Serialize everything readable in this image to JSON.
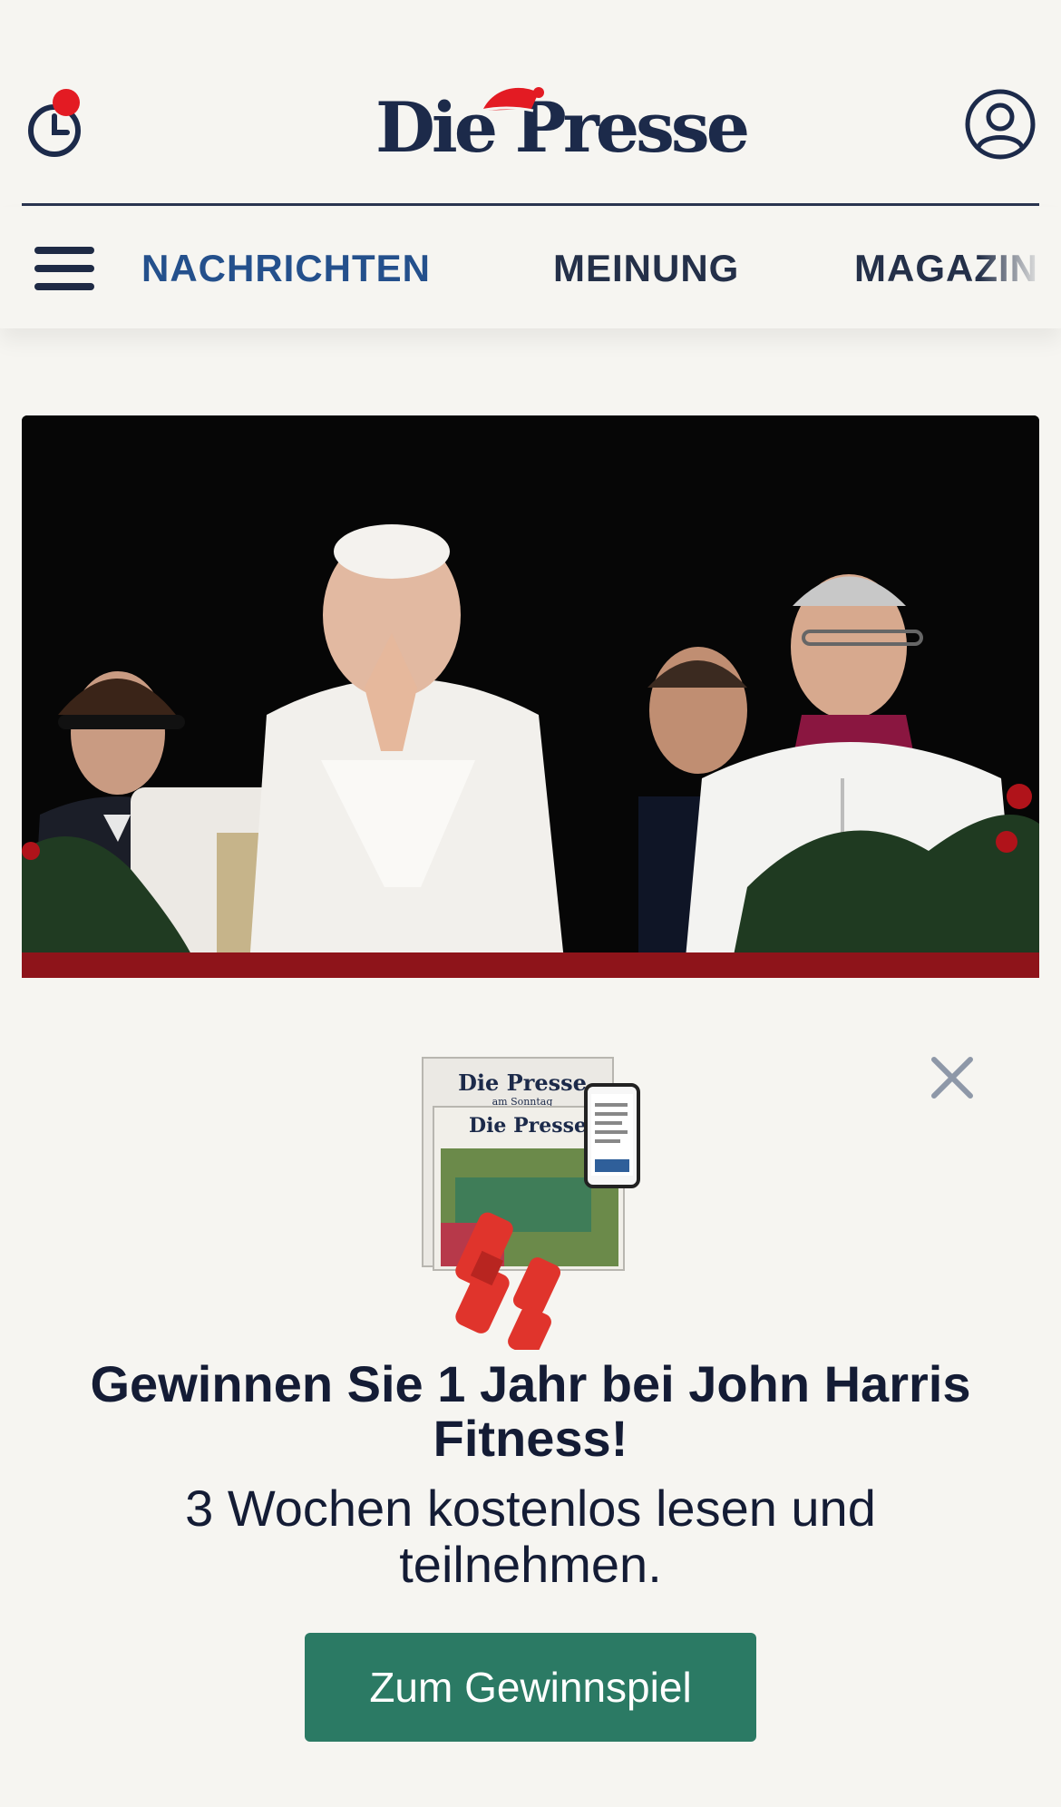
{
  "header": {
    "brand": "Die Presse",
    "history_icon": "clock-icon",
    "account_icon": "user-icon",
    "notification_dot_color": "#e31b23"
  },
  "nav": {
    "menu_icon": "hamburger-icon",
    "items": [
      {
        "label": "NACHRICHTEN",
        "active": true
      },
      {
        "label": "MEINUNG",
        "active": false
      },
      {
        "label": "MAGAZIN",
        "active": false
      }
    ]
  },
  "hero": {
    "image": "photo"
  },
  "promo": {
    "close_icon": "close-icon",
    "image": "newspaper-and-dumbbells",
    "paper_title_1": "Die Presse",
    "paper_subtitle_1": "am Sonntag",
    "paper_title_2": "Die Presse",
    "title": "Gewinnen Sie 1 Jahr bei John Harris Fitness!",
    "subtitle": "3 Wochen kostenlos lesen und teilnehmen.",
    "button_label": "Zum Gewinnspiel",
    "button_color": "#2b7a64"
  }
}
